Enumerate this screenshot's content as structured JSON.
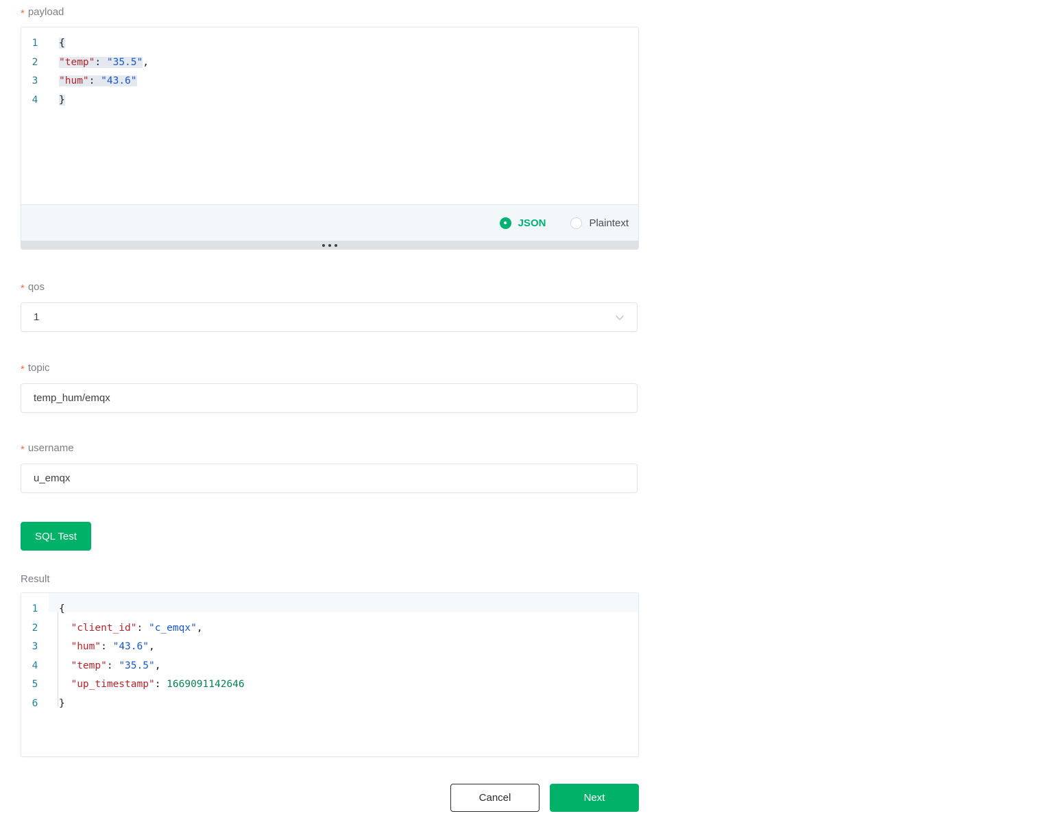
{
  "form": {
    "payload": {
      "label": "payload",
      "required": true,
      "required_marker": "*",
      "code_lines": [
        {
          "n": "1",
          "segments": [
            {
              "t": "{",
              "cls": "tok-brace",
              "hl": true
            }
          ]
        },
        {
          "n": "2",
          "segments": [
            {
              "t": "\"temp\"",
              "cls": "tok-key",
              "hl": true
            },
            {
              "t": ":",
              "cls": "tok-punct",
              "hl": true
            },
            {
              "t": " ",
              "cls": "tok-punct",
              "hl": true
            },
            {
              "t": "\"35.5\"",
              "cls": "tok-str",
              "hl": true
            },
            {
              "t": ",",
              "cls": "tok-punct",
              "hl": false
            }
          ]
        },
        {
          "n": "3",
          "segments": [
            {
              "t": "\"hum\"",
              "cls": "tok-key",
              "hl": true
            },
            {
              "t": ":",
              "cls": "tok-punct",
              "hl": true
            },
            {
              "t": " ",
              "cls": "tok-punct",
              "hl": true
            },
            {
              "t": "\"43.6\"",
              "cls": "tok-str",
              "hl": true
            }
          ]
        },
        {
          "n": "4",
          "segments": [
            {
              "t": "}",
              "cls": "tok-brace",
              "hl": true
            }
          ]
        }
      ],
      "format_options": [
        {
          "label": "JSON",
          "selected": true
        },
        {
          "label": "Plaintext",
          "selected": false
        }
      ]
    },
    "qos": {
      "label": "qos",
      "required_marker": "*",
      "value": "1",
      "icon": "chevron-down-icon"
    },
    "topic": {
      "label": "topic",
      "required_marker": "*",
      "value": "temp_hum/emqx"
    },
    "username": {
      "label": "username",
      "required_marker": "*",
      "value": "u_emqx"
    },
    "sql_test_button": "SQL Test",
    "result": {
      "label": "Result",
      "code_lines": [
        {
          "n": "1",
          "segments": [
            {
              "t": "{",
              "cls": "tok-brace"
            }
          ]
        },
        {
          "n": "2",
          "segments": [
            {
              "t": "  ",
              "cls": "tok-punct"
            },
            {
              "t": "\"client_id\"",
              "cls": "tok-key"
            },
            {
              "t": ": ",
              "cls": "tok-punct"
            },
            {
              "t": "\"c_emqx\"",
              "cls": "tok-str"
            },
            {
              "t": ",",
              "cls": "tok-punct"
            }
          ]
        },
        {
          "n": "3",
          "segments": [
            {
              "t": "  ",
              "cls": "tok-punct"
            },
            {
              "t": "\"hum\"",
              "cls": "tok-key"
            },
            {
              "t": ": ",
              "cls": "tok-punct"
            },
            {
              "t": "\"43.6\"",
              "cls": "tok-str"
            },
            {
              "t": ",",
              "cls": "tok-punct"
            }
          ]
        },
        {
          "n": "4",
          "segments": [
            {
              "t": "  ",
              "cls": "tok-punct"
            },
            {
              "t": "\"temp\"",
              "cls": "tok-key"
            },
            {
              "t": ": ",
              "cls": "tok-punct"
            },
            {
              "t": "\"35.5\"",
              "cls": "tok-str"
            },
            {
              "t": ",",
              "cls": "tok-punct"
            }
          ]
        },
        {
          "n": "5",
          "segments": [
            {
              "t": "  ",
              "cls": "tok-punct"
            },
            {
              "t": "\"up_timestamp\"",
              "cls": "tok-key"
            },
            {
              "t": ": ",
              "cls": "tok-punct"
            },
            {
              "t": "1669091142646",
              "cls": "tok-num"
            }
          ]
        },
        {
          "n": "6",
          "segments": [
            {
              "t": "}",
              "cls": "tok-brace"
            }
          ]
        }
      ]
    }
  },
  "footer": {
    "cancel_label": "Cancel",
    "next_label": "Next"
  },
  "colors": {
    "accent_green": "#00b268",
    "radio_green": "#00b173",
    "required_star": "#e8714a",
    "json_key": "#b3252b",
    "json_string": "#1a56c4",
    "json_number": "#0a8055",
    "line_number": "#2b7b8c",
    "selection_highlight": "#e4e8ef"
  }
}
